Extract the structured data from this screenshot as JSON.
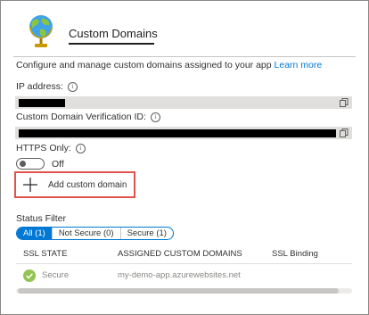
{
  "header": {
    "title": "Custom Domains",
    "icon": "globe-icon"
  },
  "description": {
    "text": "Configure and manage custom domains assigned to your app",
    "link": "Learn more"
  },
  "ip_address": {
    "label": "IP address:",
    "info_icon": "i"
  },
  "verification_id": {
    "label": "Custom Domain Verification ID:",
    "info_icon": "i"
  },
  "https_only": {
    "label": "HTTPS Only:",
    "info_icon": "i",
    "state": "Off"
  },
  "add_domain": {
    "label": "Add custom domain",
    "highlight_color": "#e0524a"
  },
  "status_filter": {
    "label": "Status Filter",
    "options": [
      "All (1)",
      "Not Secure (0)",
      "Secure (1)"
    ],
    "selected": "All (1)"
  },
  "table": {
    "columns": [
      "SSL STATE",
      "ASSIGNED CUSTOM DOMAINS",
      "SSL Binding"
    ],
    "rows": [
      {
        "ssl_state": "Secure",
        "domain": "my-demo-app.azurewebsites.net",
        "ssl_binding": ""
      }
    ]
  },
  "colors": {
    "accent": "#0078d4",
    "success": "#92c353",
    "highlight": "#e0524a"
  }
}
